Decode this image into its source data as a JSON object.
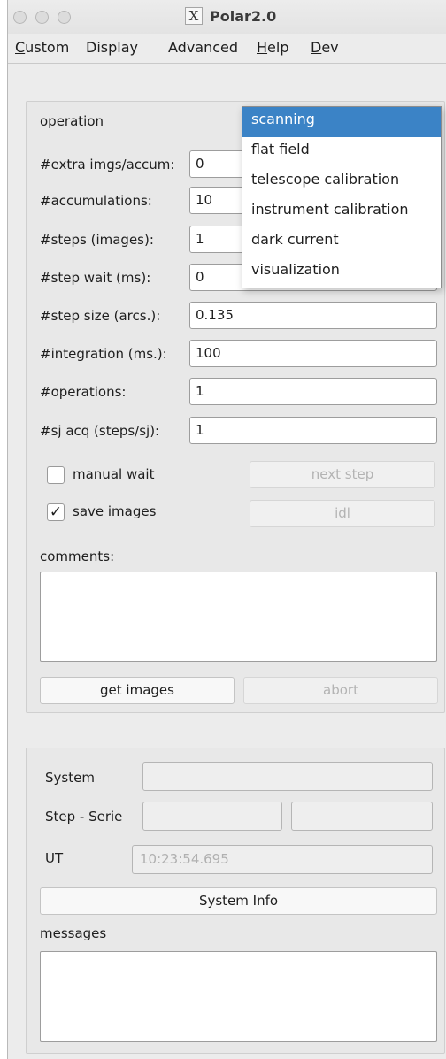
{
  "window": {
    "title": "Polar2.0",
    "title_icon": "X"
  },
  "menubar": {
    "items": [
      {
        "label": "Custom",
        "mnemonic": "C",
        "rest": "ustom"
      },
      {
        "label": "Display",
        "mnemonic": "",
        "rest": "Display"
      },
      {
        "label": "Advanced",
        "mnemonic": "",
        "rest": "Advanced"
      },
      {
        "label": "Help",
        "mnemonic": "H",
        "rest": "elp"
      },
      {
        "label": "Dev",
        "mnemonic": "D",
        "rest": "ev"
      }
    ]
  },
  "operation": {
    "label": "operation",
    "selected": "scanning",
    "options": [
      "scanning",
      "flat field",
      "telescope calibration",
      "instrument calibration",
      "dark current",
      "visualization"
    ]
  },
  "params": [
    {
      "label": "#extra imgs/accum:",
      "value": "0"
    },
    {
      "label": "#accumulations:",
      "value": "10"
    },
    {
      "label": "#steps (images):",
      "value": "1"
    },
    {
      "label": "#step wait (ms):",
      "value": "0"
    },
    {
      "label": "#step size (arcs.):",
      "value": "0.135"
    },
    {
      "label": "#integration (ms.):",
      "value": "100"
    },
    {
      "label": "#operations:",
      "value": "1"
    },
    {
      "label": "#sj acq (steps/sj):",
      "value": "1"
    }
  ],
  "options": {
    "manual_wait": {
      "label": "manual wait",
      "checked": false,
      "mark": ""
    },
    "save_images": {
      "label": "save images",
      "checked": true,
      "mark": "✓"
    }
  },
  "buttons": {
    "next_step": "next step",
    "idl": "idl",
    "get_images": "get images",
    "abort": "abort",
    "system_info": "System Info"
  },
  "comments": {
    "label": "comments:",
    "value": ""
  },
  "status": {
    "system_label": "System",
    "system_value": "",
    "step_serie_label": "Step - Serie",
    "step_value": "",
    "serie_value": "",
    "ut_label": "UT",
    "ut_value": "10:23:54.695"
  },
  "messages": {
    "label": "messages",
    "value": ""
  },
  "colors": {
    "selection": "#3b83c6",
    "window_bg": "#ececec",
    "disabled_text": "#b3b3b3"
  }
}
